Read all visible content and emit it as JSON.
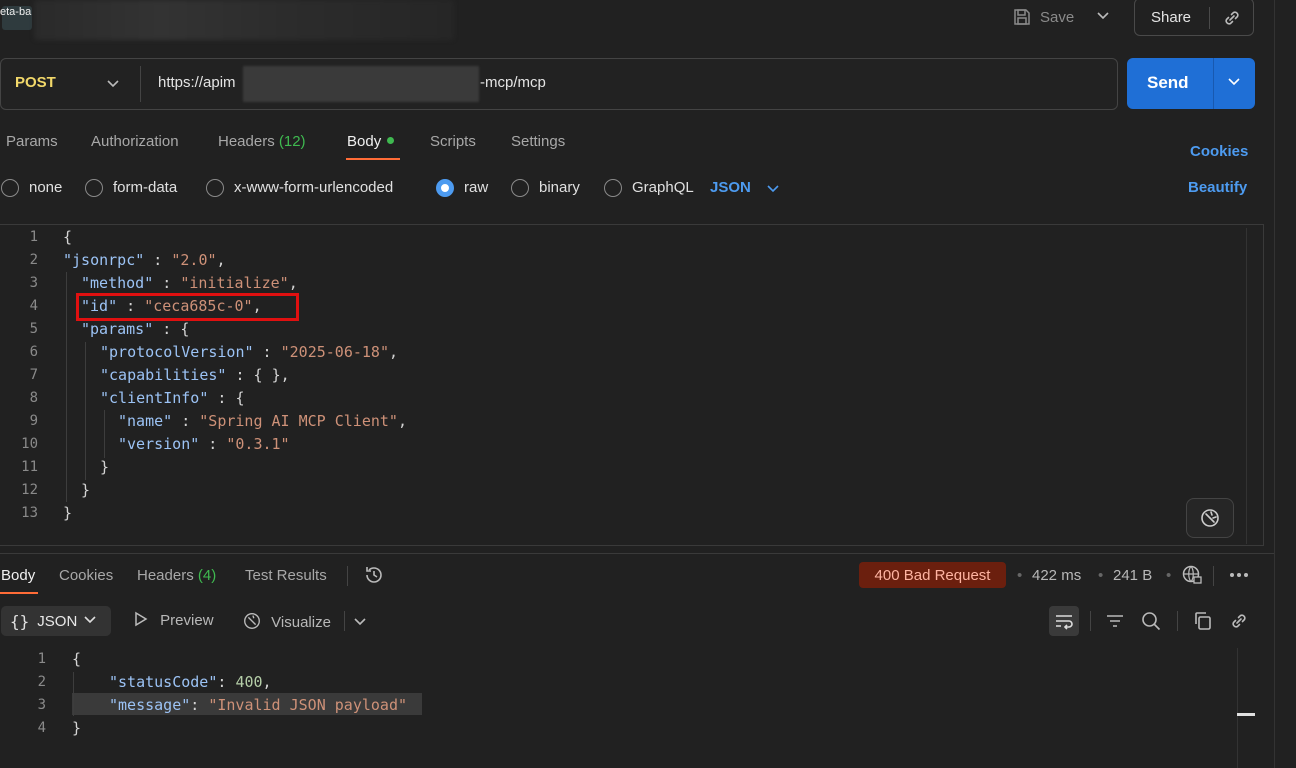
{
  "tab": {
    "title_fragment": "eta-ba"
  },
  "toolbar": {
    "save_label": "Save",
    "share_label": "Share"
  },
  "request": {
    "method": "POST",
    "url_start": "https://apim",
    "url_end": "-mcp/mcp",
    "send_label": "Send"
  },
  "request_tabs": {
    "params": "Params",
    "authorization": "Authorization",
    "headers": "Headers",
    "headers_count": "(12)",
    "body": "Body",
    "scripts": "Scripts",
    "settings": "Settings",
    "cookies": "Cookies"
  },
  "body_types": {
    "none": "none",
    "form_data": "form-data",
    "urlencoded": "x-www-form-urlencoded",
    "raw": "raw",
    "binary": "binary",
    "graphql": "GraphQL",
    "language": "JSON",
    "beautify": "Beautify"
  },
  "request_body": {
    "line_numbers": [
      "1",
      "2",
      "3",
      "4",
      "5",
      "6",
      "7",
      "8",
      "9",
      "10",
      "11",
      "12",
      "13"
    ],
    "l1": "{",
    "l2_key": "\"jsonrpc\"",
    "l2_sep": " : ",
    "l2_val": "\"2.0\"",
    "l2_end": ",",
    "l3_key": "\"method\"",
    "l3_sep": " : ",
    "l3_val": "\"initialize\"",
    "l3_end": ",",
    "l4_key": "\"id\"",
    "l4_sep": " : ",
    "l4_val": "\"ceca685c-0\"",
    "l4_end": ",",
    "l5_key": "\"params\"",
    "l5_sep": " : {",
    "l6_key": "\"protocolVersion\"",
    "l6_sep": " : ",
    "l6_val": "\"2025-06-18\"",
    "l6_end": ",",
    "l7_key": "\"capabilities\"",
    "l7_sep": " : { },",
    "l8_key": "\"clientInfo\"",
    "l8_sep": " : {",
    "l9_key": "\"name\"",
    "l9_sep": " : ",
    "l9_val": "\"Spring AI MCP Client\"",
    "l9_end": ",",
    "l10_key": "\"version\"",
    "l10_sep": " : ",
    "l10_val": "\"0.3.1\"",
    "l11": "}",
    "l12": "}",
    "l13": "}"
  },
  "response_tabs": {
    "body": "Body",
    "cookies": "Cookies",
    "headers": "Headers",
    "headers_count": "(4)",
    "test_results": "Test Results"
  },
  "response_meta": {
    "status": "400 Bad Request",
    "time": "422 ms",
    "size": "241 B",
    "status_color": "#6b1f0e"
  },
  "response_view": {
    "format": "JSON",
    "braces": "{}",
    "preview": "Preview",
    "visualize": "Visualize"
  },
  "response_body": {
    "line_numbers": [
      "1",
      "2",
      "3",
      "4"
    ],
    "l1": "{",
    "l2_key": "\"statusCode\"",
    "l2_sep": ": ",
    "l2_val": "400",
    "l2_end": ",",
    "l3_key": "\"message\"",
    "l3_sep": ": ",
    "l3_val": "\"Invalid JSON payload\"",
    "l4": "}"
  },
  "icons": [
    "save-icon",
    "chevron-down-icon",
    "link-icon",
    "history-icon",
    "globe-lock-icon",
    "more-icon",
    "wrap-icon",
    "filter-icon",
    "search-icon",
    "copy-icon",
    "play-icon",
    "visualize-icon",
    "magic-icon"
  ],
  "colors": {
    "accent": "#1f6fd6",
    "method": "#f2d86a",
    "link": "#4d9bf0",
    "active_tab": "#ff6c37"
  }
}
